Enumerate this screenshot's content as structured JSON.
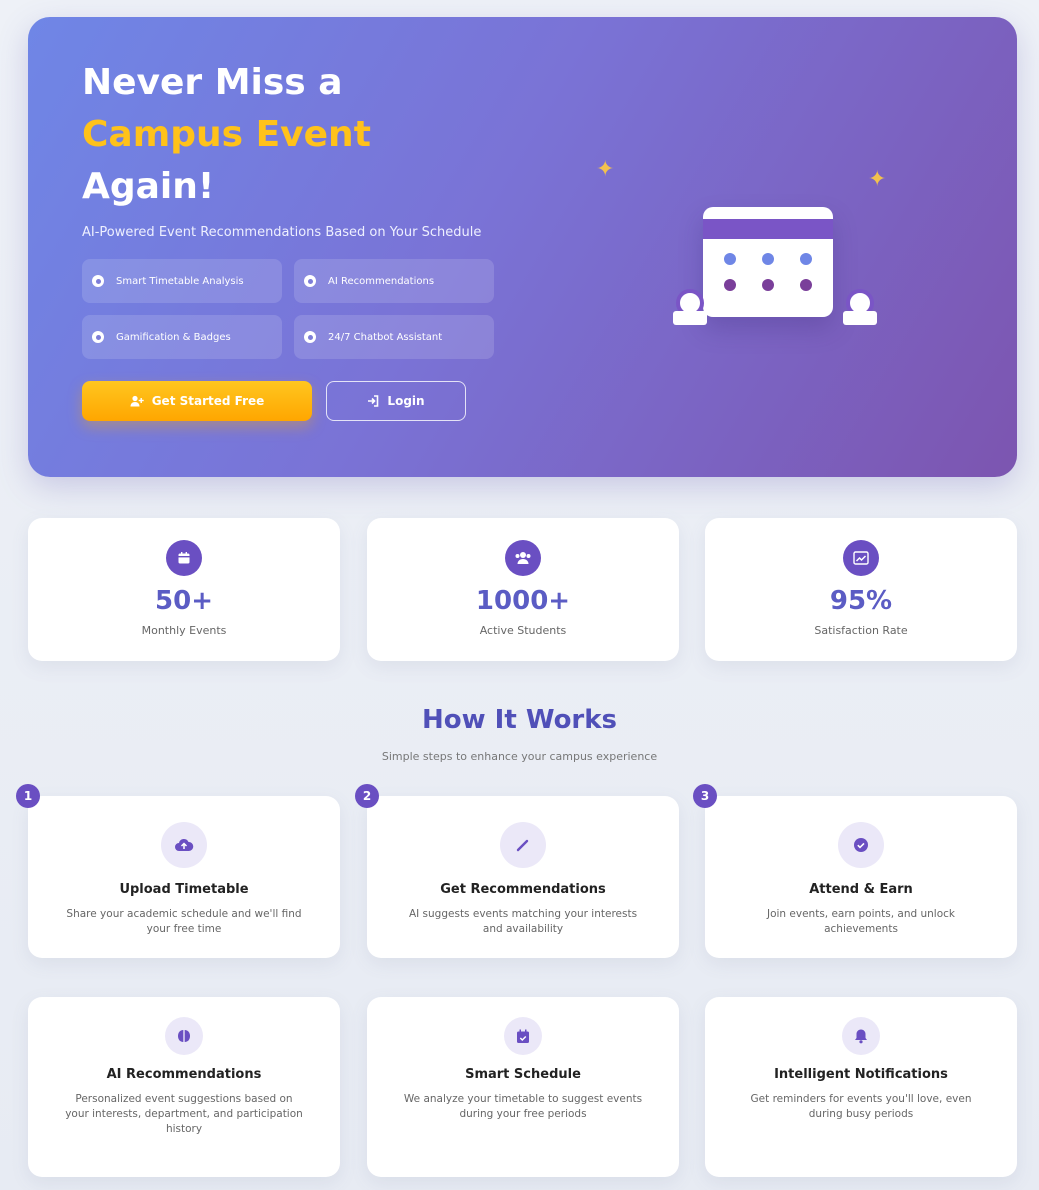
{
  "hero": {
    "title_line1": "Never Miss a",
    "title_accent": "Campus Event",
    "title_line3": "Again!",
    "subtitle": "AI-Powered Event Recommendations Based on Your Schedule",
    "features": [
      {
        "label": "Smart Timetable Analysis",
        "icon": "clock-icon"
      },
      {
        "label": "AI Recommendations",
        "icon": "robot-icon"
      },
      {
        "label": "Gamification & Badges",
        "icon": "trophy-icon"
      },
      {
        "label": "24/7 Chatbot Assistant",
        "icon": "chat-icon"
      }
    ],
    "primary_button": "Get Started Free",
    "secondary_button": "Login",
    "accent_color": "#ffc21a"
  },
  "stats": [
    {
      "value": "50+",
      "label": "Monthly Events",
      "icon": "calendar-icon"
    },
    {
      "value": "1000+",
      "label": "Active Students",
      "icon": "users-icon"
    },
    {
      "value": "95%",
      "label": "Satisfaction Rate",
      "icon": "chart-line-icon"
    }
  ],
  "how_it_works": {
    "title": "How It Works",
    "subtitle": "Simple steps to enhance your campus experience",
    "steps": [
      {
        "number": "1",
        "title": "Upload Timetable",
        "description": "Share your academic schedule and we'll find your free time",
        "icon": "cloud-upload-icon"
      },
      {
        "number": "2",
        "title": "Get Recommendations",
        "description": "AI suggests events matching your interests and availability",
        "icon": "magic-wand-icon"
      },
      {
        "number": "3",
        "title": "Attend & Earn",
        "description": "Join events, earn points, and unlock achievements",
        "icon": "check-circle-icon"
      }
    ]
  },
  "features": [
    {
      "title": "AI Recommendations",
      "description": "Personalized event suggestions based on your interests, department, and participation history",
      "icon": "brain-icon"
    },
    {
      "title": "Smart Schedule",
      "description": "We analyze your timetable to suggest events during your free periods",
      "icon": "calendar-check-icon"
    },
    {
      "title": "Intelligent Notifications",
      "description": "Get reminders for events you'll love, even during busy periods",
      "icon": "bell-icon"
    }
  ],
  "colors": {
    "brand": "#6a4fc2",
    "stat_number": "#5b5cc4",
    "title": "#5050b8"
  }
}
